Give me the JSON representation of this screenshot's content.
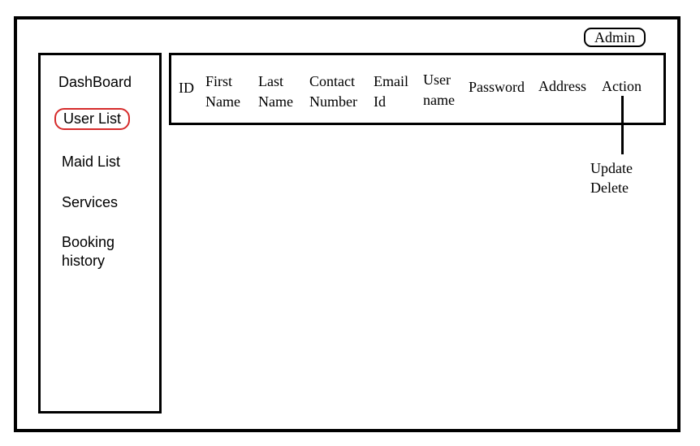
{
  "header": {
    "admin_label": "Admin"
  },
  "sidebar": {
    "items": [
      {
        "label": "DashBoard"
      },
      {
        "label": "User List",
        "active": true
      },
      {
        "label": "Maid List"
      },
      {
        "label": "Services"
      },
      {
        "label": "Booking",
        "label2": "history"
      }
    ],
    "active_border_color": "#d62b2b"
  },
  "table": {
    "columns": [
      {
        "line1": "ID"
      },
      {
        "line1": "First",
        "line2": "Name"
      },
      {
        "line1": "Last",
        "line2": "Name"
      },
      {
        "line1": "Contact",
        "line2": "Number"
      },
      {
        "line1": "Email",
        "line2": "Id"
      },
      {
        "line1": "User",
        "line2": "name"
      },
      {
        "line1": "Password"
      },
      {
        "line1": "Address"
      },
      {
        "line1": "Action"
      }
    ],
    "action_options": [
      "Update",
      "Delete"
    ]
  }
}
